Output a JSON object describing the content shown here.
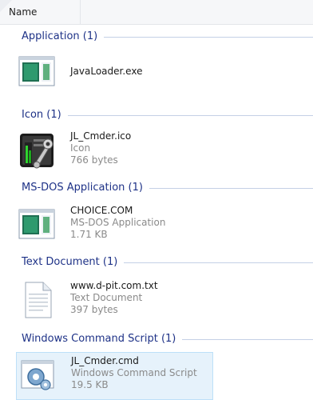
{
  "header": {
    "name_label": "Name"
  },
  "groups": [
    {
      "label": "Application (1)"
    },
    {
      "label": "Icon (1)"
    },
    {
      "label": "MS-DOS Application (1)"
    },
    {
      "label": "Text Document (1)"
    },
    {
      "label": "Windows Command Script (1)"
    }
  ],
  "files": [
    {
      "name": "JavaLoader.exe",
      "type": "",
      "size": "",
      "icon": "application-window-icon"
    },
    {
      "name": "JL_Cmder.ico",
      "type": "Icon",
      "size": "766 bytes",
      "icon": "jl-cmder-tool-icon"
    },
    {
      "name": "CHOICE.COM",
      "type": "MS-DOS Application",
      "size": "1.71 KB",
      "icon": "application-window-icon"
    },
    {
      "name": "www.d-pit.com.txt",
      "type": "Text Document",
      "size": "397 bytes",
      "icon": "text-document-icon"
    },
    {
      "name": "JL_Cmder.cmd",
      "type": "Windows Command Script",
      "size": "19.5 KB",
      "icon": "command-script-gear-icon"
    }
  ],
  "colors": {
    "group_header": "#1e3287",
    "group_line": "#c5d0e6",
    "selected_bg": "#e6f2fb",
    "selected_border": "#bde0f8",
    "meta_text": "#8a8a8a"
  }
}
